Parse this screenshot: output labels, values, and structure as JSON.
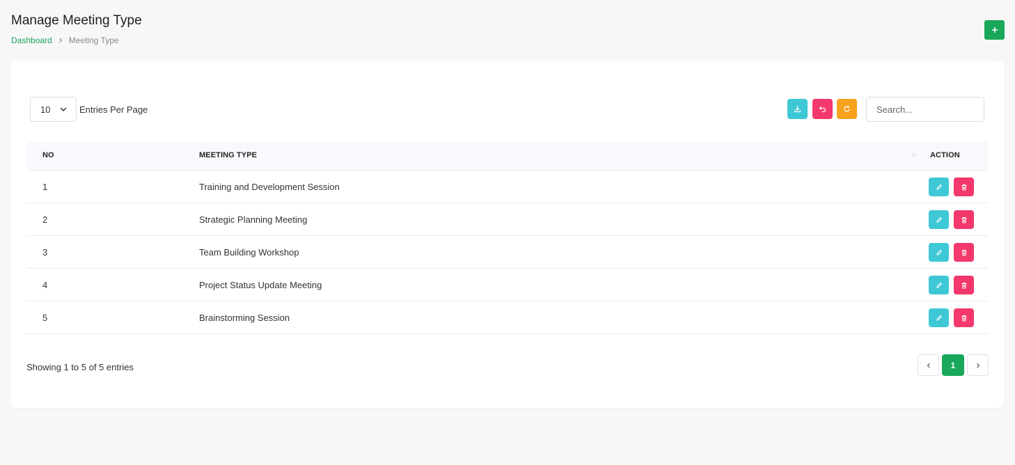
{
  "header": {
    "title": "Manage Meeting Type",
    "breadcrumb": {
      "home": "Dashboard",
      "current": "Meeting Type"
    },
    "add_label": "+"
  },
  "toolbar": {
    "entries_value": "10",
    "entries_label": "Entries Per Page",
    "search_placeholder": "Search...",
    "icons": {
      "download": "download-icon",
      "undo": "undo-icon",
      "refresh": "refresh-icon"
    }
  },
  "table": {
    "columns": [
      "NO",
      "MEETING TYPE",
      "ACTION"
    ],
    "rows": [
      {
        "no": "1",
        "type": "Training and Development Session"
      },
      {
        "no": "2",
        "type": "Strategic Planning Meeting"
      },
      {
        "no": "3",
        "type": "Team Building Workshop"
      },
      {
        "no": "4",
        "type": "Project Status Update Meeting"
      },
      {
        "no": "5",
        "type": "Brainstorming Session"
      }
    ]
  },
  "footer": {
    "showing": "Showing 1 to 5 of 5 entries",
    "current_page": "1"
  },
  "colors": {
    "primary_green": "#19a75a",
    "cyan": "#3ec8d6",
    "pink": "#f2386c",
    "orange": "#f7a21f"
  }
}
